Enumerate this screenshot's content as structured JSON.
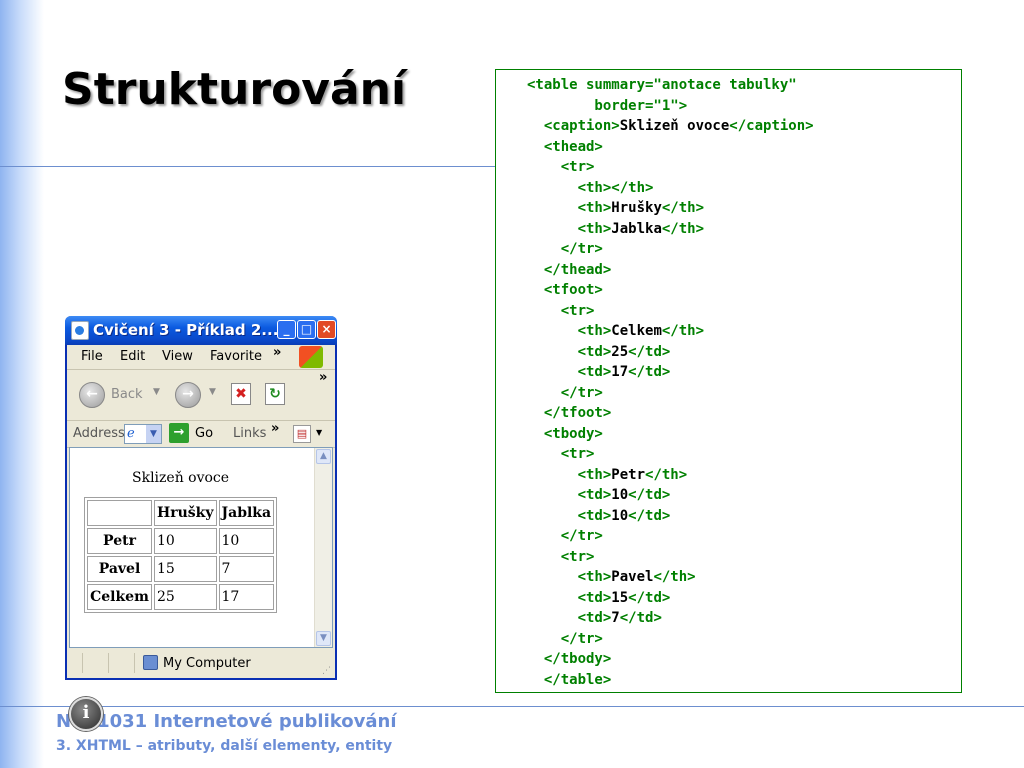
{
  "slide": {
    "title": "Strukturování",
    "footer": {
      "course_prefix": "N",
      "course_suffix": "1031 Internetové publikování",
      "subtitle": "3. XHTML – atributy, další elementy, entity"
    }
  },
  "code": {
    "lines": [
      {
        "tag": "<table summary=\"anotace tabulky\"",
        "text": "",
        "close": ""
      },
      {
        "tag": "        border=\"1\">",
        "text": "",
        "close": ""
      },
      {
        "tag": "  <caption>",
        "text": "Sklizeň ovoce",
        "close": "</caption>"
      },
      {
        "tag": "  <thead>",
        "text": "",
        "close": ""
      },
      {
        "tag": "    <tr>",
        "text": "",
        "close": ""
      },
      {
        "tag": "      <th></th>",
        "text": "",
        "close": ""
      },
      {
        "tag": "      <th>",
        "text": "Hrušky",
        "close": "</th>"
      },
      {
        "tag": "      <th>",
        "text": "Jablka",
        "close": "</th>"
      },
      {
        "tag": "    </tr>",
        "text": "",
        "close": ""
      },
      {
        "tag": "  </thead>",
        "text": "",
        "close": ""
      },
      {
        "tag": "  <tfoot>",
        "text": "",
        "close": ""
      },
      {
        "tag": "    <tr>",
        "text": "",
        "close": ""
      },
      {
        "tag": "      <th>",
        "text": "Celkem",
        "close": "</th>"
      },
      {
        "tag": "      <td>",
        "text": "25",
        "close": "</td>"
      },
      {
        "tag": "      <td>",
        "text": "17",
        "close": "</td>"
      },
      {
        "tag": "    </tr>",
        "text": "",
        "close": ""
      },
      {
        "tag": "  </tfoot>",
        "text": "",
        "close": ""
      },
      {
        "tag": "  <tbody>",
        "text": "",
        "close": ""
      },
      {
        "tag": "    <tr>",
        "text": "",
        "close": ""
      },
      {
        "tag": "      <th>",
        "text": "Petr",
        "close": "</th>"
      },
      {
        "tag": "      <td>",
        "text": "10",
        "close": "</td>"
      },
      {
        "tag": "      <td>",
        "text": "10",
        "close": "</td>"
      },
      {
        "tag": "    </tr>",
        "text": "",
        "close": ""
      },
      {
        "tag": "    <tr>",
        "text": "",
        "close": ""
      },
      {
        "tag": "      <th>",
        "text": "Pavel",
        "close": "</th>"
      },
      {
        "tag": "      <td>",
        "text": "15",
        "close": "</td>"
      },
      {
        "tag": "      <td>",
        "text": "7",
        "close": "</td>"
      },
      {
        "tag": "    </tr>",
        "text": "",
        "close": ""
      },
      {
        "tag": "  </tbody>",
        "text": "",
        "close": ""
      },
      {
        "tag": "  </table>",
        "text": "",
        "close": ""
      }
    ]
  },
  "browser": {
    "title": "Cvičení 3 - Příklad 2...",
    "menu": [
      "File",
      "Edit",
      "View",
      "Favorite",
      "»"
    ],
    "toolbar": {
      "back_label": "Back",
      "more": "»"
    },
    "address": {
      "label": "Address",
      "go_label": "Go",
      "links_label": "Links",
      "more": "»"
    },
    "status": {
      "zone_label": "My Computer"
    },
    "page": {
      "caption": "Sklizeň ovoce",
      "header": [
        "",
        "Hrušky",
        "Jablka"
      ],
      "rows": [
        [
          "Petr",
          "10",
          "10"
        ],
        [
          "Pavel",
          "15",
          "7"
        ],
        [
          "Celkem",
          "25",
          "17"
        ]
      ]
    }
  }
}
